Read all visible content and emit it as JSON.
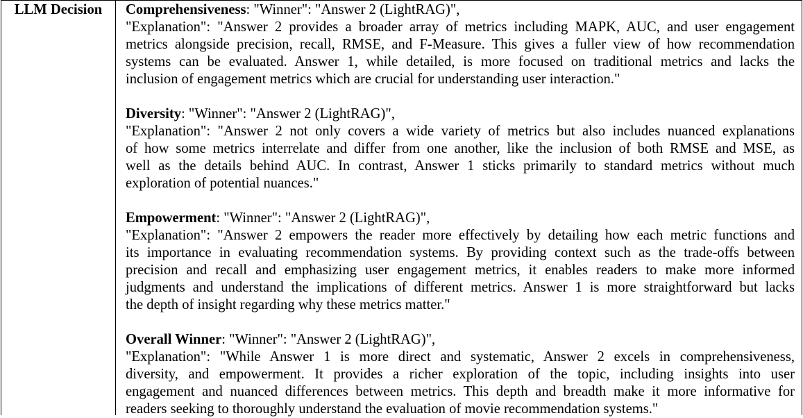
{
  "row_label": "LLM Decision",
  "sections": [
    {
      "criterion": "Comprehensiveness",
      "winner_line": ": \"Winner\": \"Answer 2 (LightRAG)\",",
      "explanation_lines": [
        "\"Explanation\": \"Answer 2 provides a broader array of metrics including MAPK, AUC, and user engagement",
        "metrics alongside precision, recall, RMSE, and F-Measure. This gives a fuller view of how recommendation",
        "systems can be evaluated. Answer 1, while detailed, is more focused on traditional metrics and lacks the",
        "inclusion of engagement metrics which are crucial for understanding user interaction.\""
      ]
    },
    {
      "criterion": "Diversity",
      "winner_line": ": \"Winner\": \"Answer 2 (LightRAG)\",",
      "explanation_lines": [
        "\"Explanation\": \"Answer 2 not only covers a wide variety of metrics but also includes nuanced explanations",
        "of how some metrics interrelate and differ from one another, like the inclusion of both RMSE and MSE, as",
        "well as the details behind AUC. In contrast, Answer 1 sticks primarily to standard metrics without much",
        "exploration of potential nuances.\""
      ]
    },
    {
      "criterion": "Empowerment",
      "winner_line": ": \"Winner\": \"Answer 2 (LightRAG)\",",
      "explanation_lines": [
        "\"Explanation\": \"Answer 2 empowers the reader more effectively by detailing how each metric functions and",
        "its importance in evaluating recommendation systems. By providing context such as the trade-offs between",
        "precision and recall and emphasizing user engagement metrics, it enables readers to make more informed",
        "judgments and understand the implications of different metrics. Answer 1 is more straightforward but lacks",
        "the depth of insight regarding why these metrics matter.\""
      ]
    },
    {
      "criterion": "Overall Winner",
      "winner_line": ": \"Winner\": \"Answer 2 (LightRAG)\",",
      "explanation_lines": [
        "\"Explanation\": \"While Answer 1 is more direct and systematic, Answer 2 excels in comprehensiveness,",
        "diversity, and empowerment.  It provides a richer exploration of the topic, including insights into user",
        "engagement and nuanced differences between metrics. This depth and breadth make it more informative for",
        "readers seeking to thoroughly understand the evaluation of movie recommendation systems.\""
      ]
    }
  ]
}
